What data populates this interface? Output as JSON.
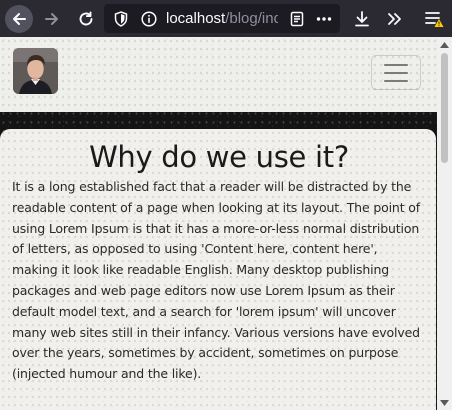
{
  "browser": {
    "url_host": "localhost",
    "url_path": "/blog/inde",
    "icons": [
      "arrow-left-icon",
      "arrow-right-icon",
      "reload-icon",
      "shield-icon",
      "info-icon",
      "reader-view-icon",
      "more-icon",
      "download-icon",
      "overflow-icon",
      "menu-icon"
    ],
    "accent": "#ffcc00"
  },
  "navbar": {
    "avatar_icon": "user-photo-avatar",
    "toggler_icon": "hamburger-icon"
  },
  "article": {
    "title": "Why do we use it?",
    "body": "It is a long established fact that a reader will be distracted by the readable content of a page when looking at its layout. The point of using Lorem Ipsum is that it has a more-or-less normal distribution of letters, as opposed to using 'Content here, content here', making it look like readable English. Many desktop publishing packages and web page editors now use Lorem Ipsum as their default model text, and a search for 'lorem ipsum' will uncover many web sites still in their infancy. Various versions have evolved over the years, sometimes by accident, sometimes on purpose (injected humour and the like)."
  }
}
